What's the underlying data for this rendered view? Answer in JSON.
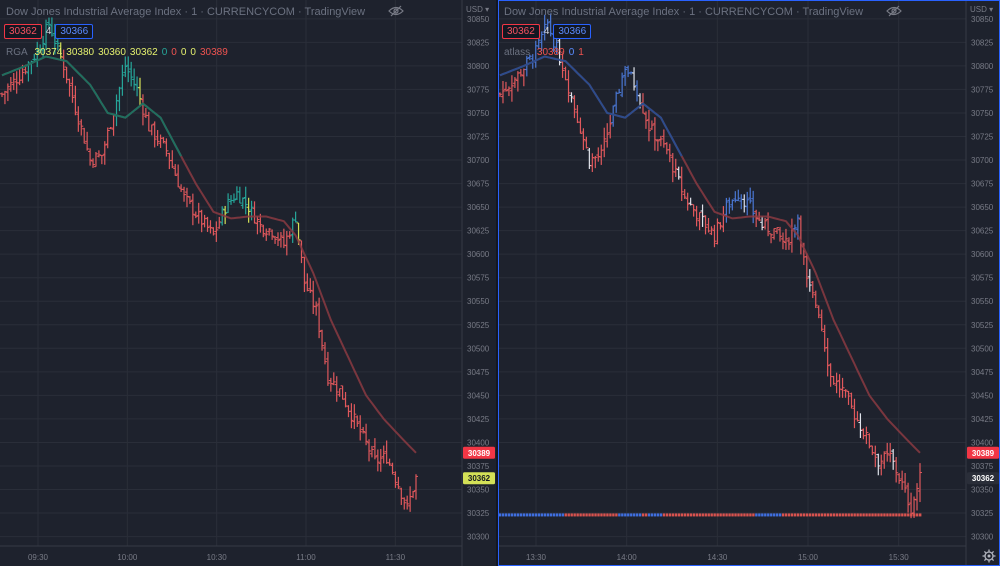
{
  "panes": [
    {
      "id": "left",
      "title": "Dow Jones Industrial Average Index · 1 · CURRENCYCOM · TradingView",
      "bid": "30362",
      "spread": "4",
      "ask": "30366",
      "indicator_name": "RGA",
      "indicator_values": [
        {
          "text": "30374",
          "color": "#e4f06e"
        },
        {
          "text": "30380",
          "color": "#e4f06e"
        },
        {
          "text": "30360",
          "color": "#e4f06e"
        },
        {
          "text": "30362",
          "color": "#e4f06e"
        },
        {
          "text": "0",
          "color": "#26a69a"
        },
        {
          "text": "0",
          "color": "#ef5350"
        },
        {
          "text": "0",
          "color": "#e4f06e"
        },
        {
          "text": "0",
          "color": "#e4f06e"
        },
        {
          "text": "30389",
          "color": "#ef5350"
        }
      ],
      "currency": "USD",
      "price_badges": [
        {
          "value": 30389,
          "label": "30389",
          "bg": "#f23645",
          "fg": "#ffffff"
        },
        {
          "value": 30362,
          "label": "30362",
          "bg": "#d4e157",
          "fg": "#131722"
        }
      ],
      "x_labels": [
        "09:30",
        "10:00",
        "10:30",
        "11:00",
        "11:30"
      ],
      "bar_color_scheme": "green-red-yellow"
    },
    {
      "id": "right",
      "title": "Dow Jones Industrial Average Index · 1 · CURRENCYCOM · TradingView",
      "bid": "30362",
      "spread": "4",
      "ask": "30366",
      "indicator_name": "atlass",
      "indicator_values": [
        {
          "text": "30389",
          "color": "#ef5350"
        },
        {
          "text": "0",
          "color": "#5b8cff"
        },
        {
          "text": "1",
          "color": "#ef5350"
        }
      ],
      "currency": "USD",
      "price_badges": [
        {
          "value": 30389,
          "label": "30389",
          "bg": "#f23645",
          "fg": "#ffffff"
        },
        {
          "value": 30362,
          "label": "30362",
          "bg": "#2a2e39",
          "fg": "#ffffff"
        }
      ],
      "x_labels": [
        "13:30",
        "14:00",
        "14:30",
        "15:00",
        "15:30"
      ],
      "bar_color_scheme": "blue-red"
    }
  ],
  "chart_data": {
    "type": "ohlc",
    "y_ticks": [
      30850,
      30825,
      30800,
      30775,
      30750,
      30725,
      30700,
      30675,
      30650,
      30625,
      30600,
      30575,
      30550,
      30525,
      30500,
      30475,
      30450,
      30425,
      30400,
      30375,
      30350,
      30325,
      30300
    ],
    "ylim": [
      30290,
      30870
    ],
    "grid": true,
    "close_path": [
      [
        0,
        30770
      ],
      [
        6,
        30790
      ],
      [
        12,
        30815
      ],
      [
        16,
        30845
      ],
      [
        21,
        30800
      ],
      [
        26,
        30745
      ],
      [
        30,
        30700
      ],
      [
        34,
        30705
      ],
      [
        37,
        30740
      ],
      [
        42,
        30800
      ],
      [
        46,
        30775
      ],
      [
        50,
        30735
      ],
      [
        56,
        30710
      ],
      [
        62,
        30660
      ],
      [
        68,
        30635
      ],
      [
        72,
        30620
      ],
      [
        76,
        30650
      ],
      [
        80,
        30665
      ],
      [
        84,
        30650
      ],
      [
        88,
        30630
      ],
      [
        92,
        30625
      ],
      [
        96,
        30610
      ],
      [
        100,
        30640
      ],
      [
        103,
        30570
      ],
      [
        107,
        30540
      ],
      [
        111,
        30470
      ],
      [
        115,
        30455
      ],
      [
        119,
        30430
      ],
      [
        123,
        30405
      ],
      [
        127,
        30380
      ],
      [
        131,
        30385
      ],
      [
        135,
        30355
      ],
      [
        138,
        30330
      ],
      [
        141,
        30362
      ]
    ],
    "ma_path": [
      [
        0,
        30790
      ],
      [
        8,
        30800
      ],
      [
        15,
        30810
      ],
      [
        22,
        30805
      ],
      [
        30,
        30780
      ],
      [
        36,
        30750
      ],
      [
        42,
        30745
      ],
      [
        48,
        30760
      ],
      [
        54,
        30745
      ],
      [
        60,
        30710
      ],
      [
        66,
        30675
      ],
      [
        72,
        30645
      ],
      [
        78,
        30638
      ],
      [
        84,
        30640
      ],
      [
        90,
        30640
      ],
      [
        96,
        30635
      ],
      [
        100,
        30620
      ],
      [
        106,
        30580
      ],
      [
        112,
        30530
      ],
      [
        118,
        30490
      ],
      [
        124,
        30450
      ],
      [
        130,
        30425
      ],
      [
        136,
        30405
      ],
      [
        141,
        30389
      ]
    ],
    "bar_count": 142,
    "bottom_strip": {
      "value": 30323,
      "blue_until_fraction": 0.62
    }
  }
}
